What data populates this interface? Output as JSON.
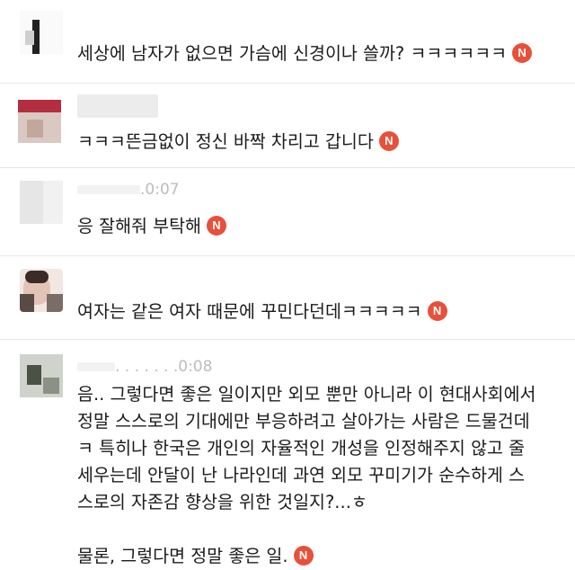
{
  "colors": {
    "badge": "#e8503a",
    "divider": "#e6e6e6",
    "text": "#1c1c1c",
    "meta": "#bdbdbd"
  },
  "badge_label": "N",
  "comments": [
    {
      "text": "세상에 남자가 없으면 가슴에 신경이나 쓸까? ㅋㅋㅋㅋㅋㅋ"
    },
    {
      "text": "ㅋㅋㅋ뜬금없이 정신 바짝 차리고 갑니다"
    },
    {
      "meta_partial": ".0:07",
      "text": "응 잘해줘 부탁해"
    },
    {
      "text": "여자는 같은 여자 때문에 꾸민다던데ㅋㅋㅋㅋㅋ"
    },
    {
      "meta_partial": ". . . . . . .0:08",
      "lines": [
        "음.. 그렇다면 좋은 일이지만 외모 뿐만 아니라 이 현대사회에서",
        "정말 스스로의 기대에만 부응하려고 살아가는 사람은 드물건데",
        "ㅋ 특히나 한국은 개인의 자율적인 개성을 인정해주지 않고 줄",
        "세우는데 안달이 난 나라인데 과연 외모 꾸미기가 순수하게 스",
        "스로의 자존감 향상을 위한 것일지?...ㅎ"
      ],
      "last_line": "물론, 그렇다면 정말 좋은 일."
    }
  ]
}
